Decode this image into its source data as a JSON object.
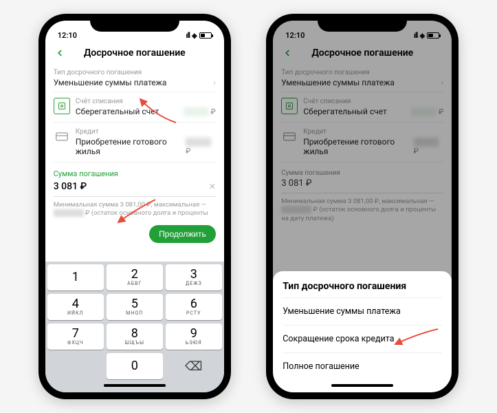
{
  "status": {
    "time": "12:10"
  },
  "nav": {
    "title": "Досрочное погашение"
  },
  "type_field": {
    "label": "Тип досрочного погашения",
    "value": "Уменьшение суммы платежа"
  },
  "account": {
    "label": "Счёт списания",
    "value": "Сберегательный счет",
    "currency": "₽"
  },
  "credit": {
    "label": "Кредит",
    "value": "Приобретение готового жилья",
    "currency": "₽"
  },
  "amount": {
    "label": "Сумма погашения",
    "value": "3 081 ₽",
    "value2": "3 081 ₽"
  },
  "hint": {
    "line1": "Минимальная сумма 3 081,00 ₽, максимальная —",
    "line2_suffix": "₽ (остаток основного долга и проценты",
    "line2b": "на дату платежа)"
  },
  "continue_label": "Продолжить",
  "keypad": {
    "1": {
      "d": "1",
      "l": ""
    },
    "2": {
      "d": "2",
      "l": "АБВГ"
    },
    "3": {
      "d": "3",
      "l": "ДЕЖЗ"
    },
    "4": {
      "d": "4",
      "l": "ИЙКЛ"
    },
    "5": {
      "d": "5",
      "l": "МНОП"
    },
    "6": {
      "d": "6",
      "l": "РСТУ"
    },
    "7": {
      "d": "7",
      "l": "ФХЦЧ"
    },
    "8": {
      "d": "8",
      "l": "ШЩЪЫ"
    },
    "9": {
      "d": "9",
      "l": "ЬЭЮЯ"
    },
    "0": {
      "d": "0",
      "l": ""
    }
  },
  "sheet": {
    "title": "Тип досрочного погашения",
    "opt1": "Уменьшение суммы платежа",
    "opt2": "Сокращение срока кредита",
    "opt3": "Полное погашение"
  }
}
